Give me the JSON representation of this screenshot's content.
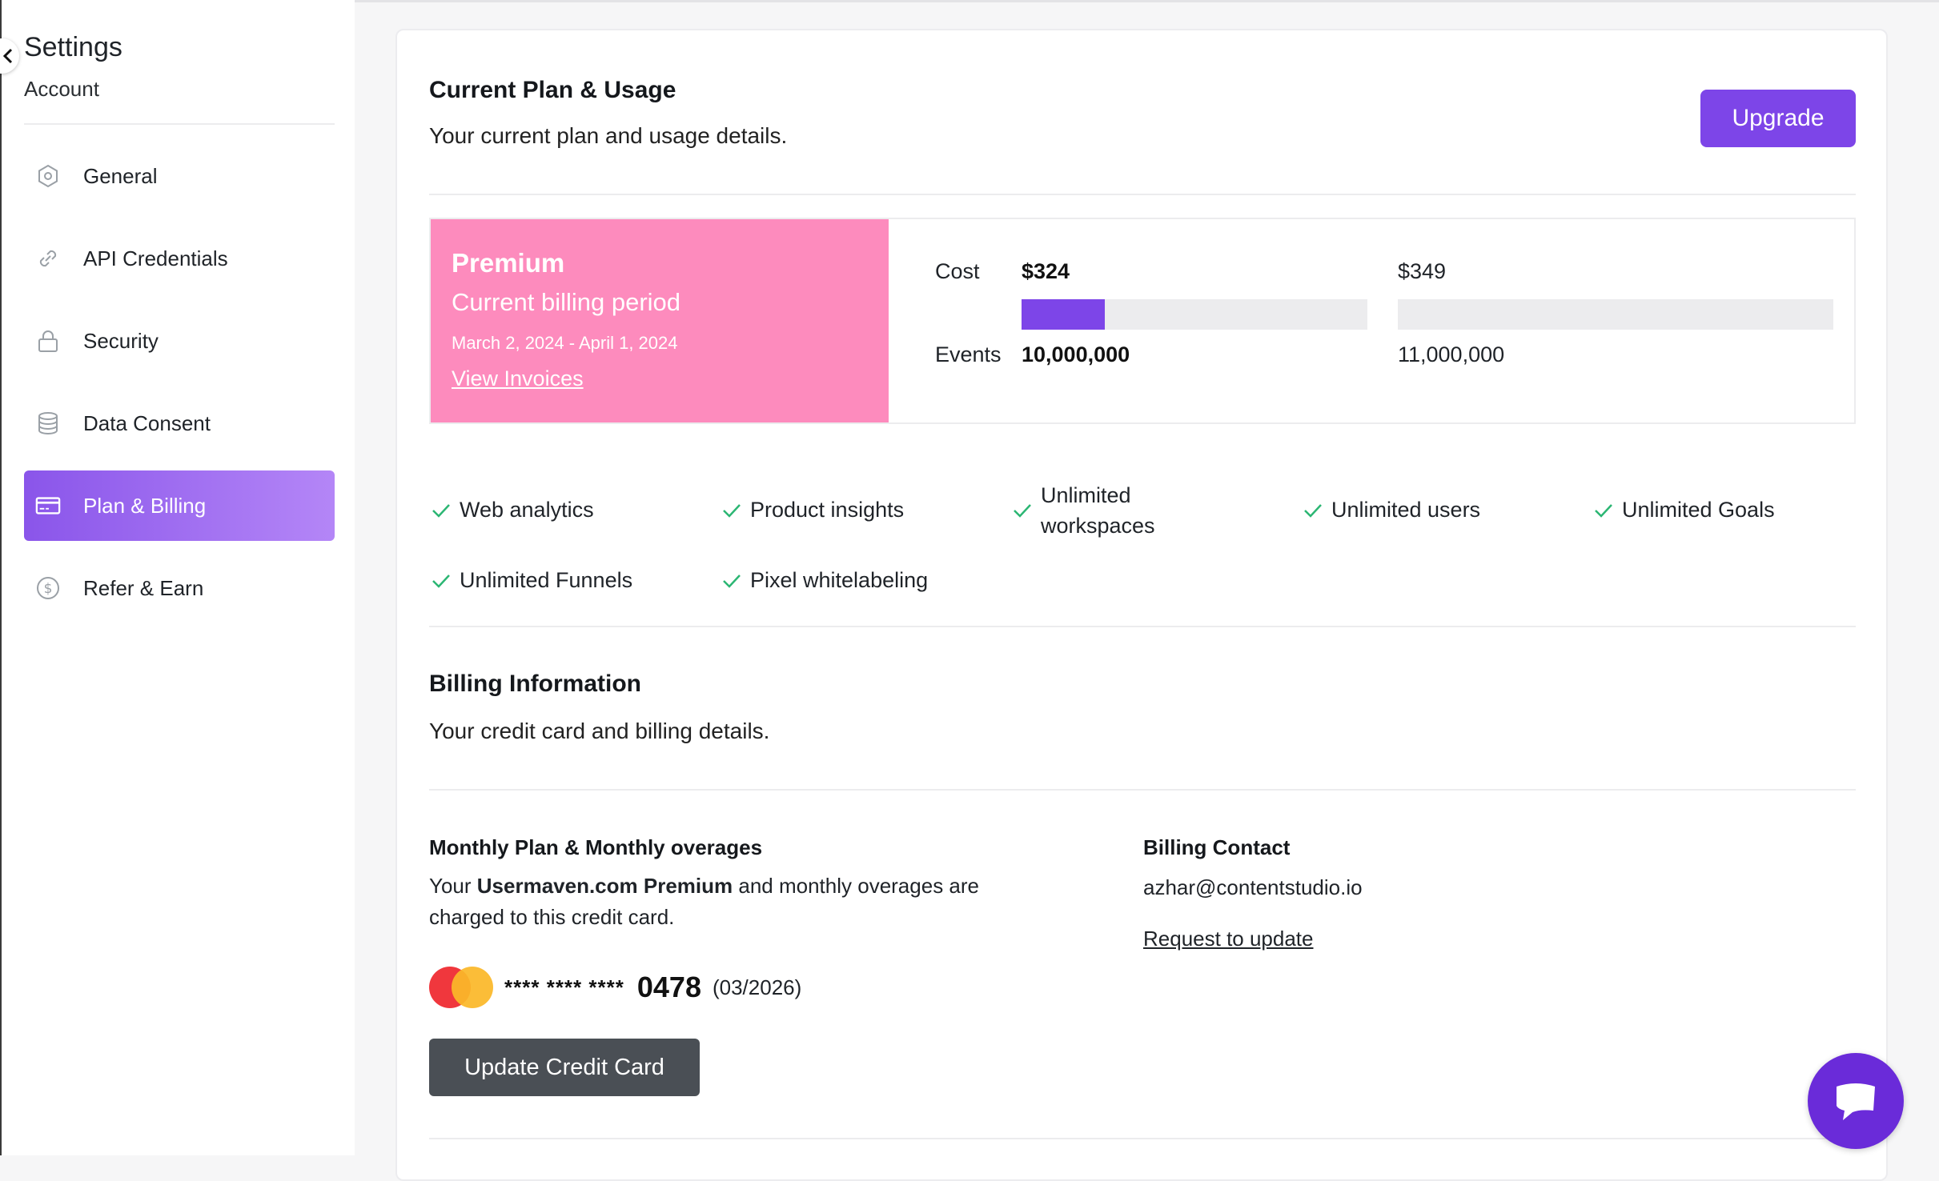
{
  "sidebar": {
    "title": "Settings",
    "subtitle": "Account",
    "items": [
      {
        "label": "General",
        "icon": "hexagon-settings-icon",
        "active": false
      },
      {
        "label": "API Credentials",
        "icon": "link-icon",
        "active": false
      },
      {
        "label": "Security",
        "icon": "lock-icon",
        "active": false
      },
      {
        "label": "Data Consent",
        "icon": "database-icon",
        "active": false
      },
      {
        "label": "Plan & Billing",
        "icon": "credit-card-icon",
        "active": true
      },
      {
        "label": "Refer & Earn",
        "icon": "dollar-circle-icon",
        "active": false
      }
    ]
  },
  "plan": {
    "title": "Current Plan & Usage",
    "subtitle": "Your current plan and usage details.",
    "upgrade_label": "Upgrade",
    "name": "Premium",
    "period_label": "Current billing period",
    "period_dates": "March 2, 2024 - April 1, 2024",
    "invoices_link": "View Invoices",
    "cost_label": "Cost",
    "cost_value": "$324",
    "cost_limit": "$349",
    "events_label": "Events",
    "events_value": "10,000,000",
    "events_limit": "11,000,000",
    "usage_fraction": 0.24
  },
  "features": [
    "Web analytics",
    "Product insights",
    "Unlimited workspaces",
    "Unlimited users",
    "Unlimited Goals",
    "Unlimited Funnels",
    "Pixel whitelabeling"
  ],
  "billing": {
    "title": "Billing Information",
    "subtitle": "Your credit card and billing details.",
    "monthly_title": "Monthly Plan & Monthly overages",
    "monthly_desc_prefix": "Your ",
    "monthly_desc_bold": "Usermaven.com Premium",
    "monthly_desc_suffix": " and monthly overages are charged to this credit card.",
    "card_mask": "**** **** ****",
    "card_last4": "0478",
    "card_expiry": "(03/2026)",
    "update_label": "Update Credit Card",
    "contact_title": "Billing Contact",
    "contact_email": "azhar@contentstudio.io",
    "request_link": "Request to update"
  },
  "colors": {
    "accent": "#7d45e8",
    "plan_pink": "#fd8bbd",
    "check": "#2bb673",
    "chat": "#6a2bd9"
  }
}
